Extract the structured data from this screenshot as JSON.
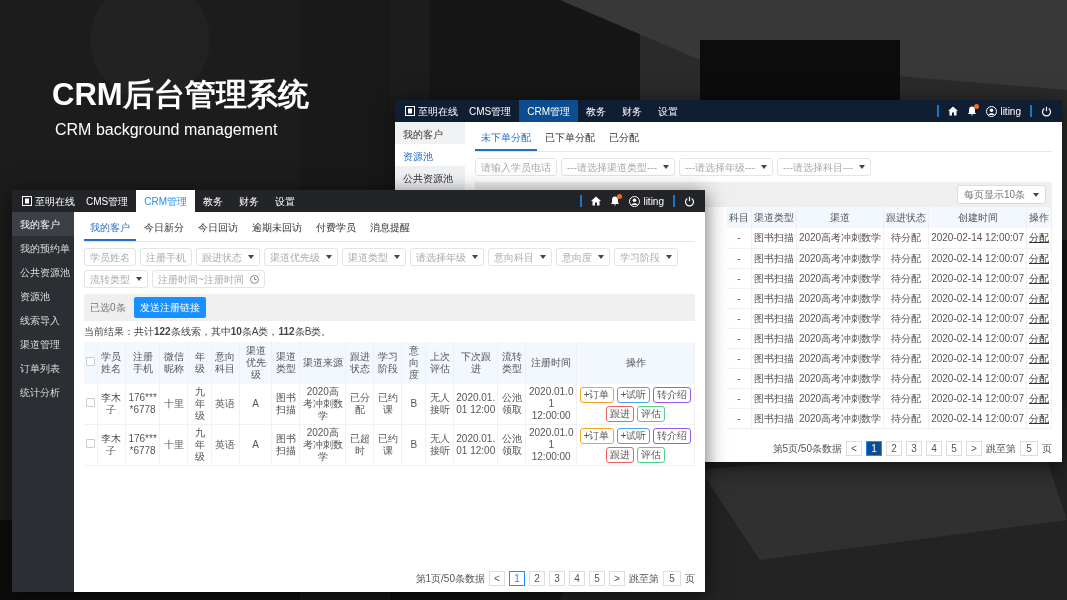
{
  "slide": {
    "title": "CRM后台管理系统",
    "subtitle": "CRM background management"
  },
  "back_window": {
    "logo": "至明在线",
    "nav": [
      {
        "label": "CMS管理",
        "selected": false
      },
      {
        "label": "CRM管理",
        "selected": true
      },
      {
        "label": "教务",
        "selected": false
      },
      {
        "label": "财务",
        "selected": false
      },
      {
        "label": "设置",
        "selected": false
      }
    ],
    "user": "liting",
    "sidebar": [
      {
        "label": "我的客户",
        "selected": false
      },
      {
        "label": "资源池",
        "selected": true
      },
      {
        "label": "公共资源池",
        "selected": false
      }
    ],
    "tabs": [
      {
        "label": "未下单分配",
        "selected": true
      },
      {
        "label": "已下单分配",
        "selected": false
      },
      {
        "label": "已分配",
        "selected": false
      }
    ],
    "filters": [
      {
        "kind": "input",
        "placeholder": "请输入学员电话"
      },
      {
        "kind": "select",
        "placeholder": "---请选择渠道类型---"
      },
      {
        "kind": "select",
        "placeholder": "---请选择年级---"
      },
      {
        "kind": "select",
        "placeholder": "---请选择科目---"
      }
    ],
    "page_size": "每页显示10条",
    "table": {
      "columns": [
        "科目",
        "渠道类型",
        "渠道",
        "跟进状态",
        "创建时间",
        "操作"
      ],
      "rows": [
        [
          "-",
          "图书扫描",
          "2020高考冲刺数学",
          "待分配",
          "2020-02-14 12:00:07",
          "分配"
        ],
        [
          "-",
          "图书扫描",
          "2020高考冲刺数学",
          "待分配",
          "2020-02-14 12:00:07",
          "分配"
        ],
        [
          "-",
          "图书扫描",
          "2020高考冲刺数学",
          "待分配",
          "2020-02-14 12:00:07",
          "分配"
        ],
        [
          "-",
          "图书扫描",
          "2020高考冲刺数学",
          "待分配",
          "2020-02-14 12:00:07",
          "分配"
        ],
        [
          "-",
          "图书扫描",
          "2020高考冲刺数学",
          "待分配",
          "2020-02-14 12:00:07",
          "分配"
        ],
        [
          "-",
          "图书扫描",
          "2020高考冲刺数学",
          "待分配",
          "2020-02-14 12:00:07",
          "分配"
        ],
        [
          "-",
          "图书扫描",
          "2020高考冲刺数学",
          "待分配",
          "2020-02-14 12:00:07",
          "分配"
        ],
        [
          "-",
          "图书扫描",
          "2020高考冲刺数学",
          "待分配",
          "2020-02-14 12:00:07",
          "分配"
        ],
        [
          "-",
          "图书扫描",
          "2020高考冲刺数学",
          "待分配",
          "2020-02-14 12:00:07",
          "分配"
        ],
        [
          "-",
          "图书扫描",
          "2020高考冲刺数学",
          "待分配",
          "2020-02-14 12:00:07",
          "分配"
        ]
      ]
    },
    "pagination": {
      "info": "第5页/50条数据",
      "prev": "<",
      "pages": [
        {
          "label": "1",
          "selected": true
        },
        {
          "label": "2",
          "selected": false
        },
        {
          "label": "3",
          "selected": false
        },
        {
          "label": "4",
          "selected": false
        },
        {
          "label": "5",
          "selected": false
        }
      ],
      "next": ">",
      "jump_label": "跳至第",
      "jump_value": "5",
      "jump_unit": "页"
    }
  },
  "front_window": {
    "logo": "至明在线",
    "nav": [
      {
        "label": "CMS管理",
        "selected": false
      },
      {
        "label": "CRM管理",
        "selected": true
      },
      {
        "label": "教务",
        "selected": false
      },
      {
        "label": "财务",
        "selected": false
      },
      {
        "label": "设置",
        "selected": false
      }
    ],
    "user": "liting",
    "sidebar": [
      {
        "label": "我的客户",
        "selected": true
      },
      {
        "label": "我的预约单",
        "selected": false
      },
      {
        "label": "公共资源池",
        "selected": false
      },
      {
        "label": "资源池",
        "selected": false
      },
      {
        "label": "线索导入",
        "selected": false
      },
      {
        "label": "渠道管理",
        "selected": false
      },
      {
        "label": "订单列表",
        "selected": false
      },
      {
        "label": "统计分析",
        "selected": false
      }
    ],
    "tabs": [
      {
        "label": "我的客户",
        "selected": true
      },
      {
        "label": "今日新分",
        "selected": false
      },
      {
        "label": "今日回访",
        "selected": false
      },
      {
        "label": "逾期未回访",
        "selected": false
      },
      {
        "label": "付费学员",
        "selected": false
      },
      {
        "label": "消息提醒",
        "selected": false
      }
    ],
    "filters": [
      {
        "kind": "input",
        "placeholder": "学员姓名"
      },
      {
        "kind": "input",
        "placeholder": "注册手机"
      },
      {
        "kind": "select",
        "placeholder": "跟进状态"
      },
      {
        "kind": "select",
        "placeholder": "渠道优先级"
      },
      {
        "kind": "select",
        "placeholder": "渠道类型"
      },
      {
        "kind": "select",
        "placeholder": "请选择年级"
      },
      {
        "kind": "select",
        "placeholder": "意向科目"
      },
      {
        "kind": "select",
        "placeholder": "意向度"
      },
      {
        "kind": "select",
        "placeholder": "学习阶段"
      },
      {
        "kind": "select",
        "placeholder": "流转类型"
      },
      {
        "kind": "date",
        "placeholder": "注册时间~注册时间"
      }
    ],
    "selected_count": "已选0条",
    "send_button": "发送注册链接",
    "result_text": "当前结果：共计**122**条线索，其中**10**条A类，**112**条B类。",
    "table": {
      "select_all_checked": false,
      "columns": [
        "学员姓名",
        "注册手机",
        "微信昵称",
        "年级",
        "意向科目",
        "渠道优先级",
        "渠道类型",
        "渠道来源",
        "跟进状态",
        "学习阶段",
        "意向度",
        "上次评估",
        "下次跟进",
        "流转类型",
        "注册时间",
        "操作"
      ],
      "rows": [
        {
          "checked": false,
          "cells": [
            "李木子",
            "176****6778",
            "十里",
            "九年级",
            "英语",
            "A",
            "图书扫描",
            "2020高考冲刺数学",
            "已分配",
            "已约课",
            "B",
            "无人接听",
            "2020.01.01 12:00",
            "公池领取",
            "2020.01.01 12:00:00"
          ],
          "actions": [
            {
              "label": "+订单",
              "color": "#f5a623"
            },
            {
              "label": "+试听",
              "color": "#4aa3f0"
            },
            {
              "label": "转介绍",
              "color": "#9b59e6"
            },
            {
              "label": "跟进",
              "color": "#f06060"
            },
            {
              "label": "评估",
              "color": "#4cd08a"
            }
          ]
        },
        {
          "checked": false,
          "cells": [
            "李木子",
            "176****6778",
            "十里",
            "九年级",
            "英语",
            "A",
            "图书扫描",
            "2020高考冲刺数学",
            "已超时",
            "已约课",
            "B",
            "无人接听",
            "2020.01.01 12:00",
            "公池领取",
            "2020.01.01 12:00:00"
          ],
          "actions": [
            {
              "label": "+订单",
              "color": "#f5a623"
            },
            {
              "label": "+试听",
              "color": "#4aa3f0"
            },
            {
              "label": "转介绍",
              "color": "#9b59e6"
            },
            {
              "label": "跟进",
              "color": "#f06060"
            },
            {
              "label": "评估",
              "color": "#4cd08a"
            }
          ]
        }
      ]
    },
    "pagination": {
      "info": "第1页/50条数据",
      "prev": "<",
      "pages": [
        {
          "label": "1",
          "selected": true
        },
        {
          "label": "2",
          "selected": false
        },
        {
          "label": "3",
          "selected": false
        },
        {
          "label": "4",
          "selected": false
        },
        {
          "label": "5",
          "selected": false
        }
      ],
      "next": ">",
      "jump_label": "跳至第",
      "jump_value": "5",
      "jump_unit": "页"
    }
  }
}
